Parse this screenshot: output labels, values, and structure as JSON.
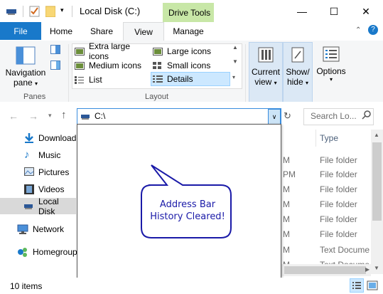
{
  "window": {
    "title": "Local Disk (C:)",
    "context_tab": "Drive Tools",
    "minimize": "—",
    "maximize": "☐",
    "close": "✕"
  },
  "tabs": [
    {
      "label": "File"
    },
    {
      "label": "Home"
    },
    {
      "label": "Share"
    },
    {
      "label": "View"
    },
    {
      "label": "Manage"
    }
  ],
  "ribbon": {
    "panes": {
      "nav_pane_line1": "Navigation",
      "nav_pane_line2": "pane",
      "group_label": "Panes"
    },
    "layout": {
      "group_label": "Layout",
      "items": [
        "Extra large icons",
        "Large icons",
        "Medium icons",
        "Small icons",
        "List",
        "Details"
      ],
      "selected": "Details"
    },
    "current_view": {
      "line1": "Current",
      "line2": "view"
    },
    "show_hide": {
      "line1": "Show/",
      "line2": "hide"
    },
    "options": {
      "label": "Options"
    }
  },
  "address": {
    "path": "C:\\",
    "search_placeholder": "Search Lo..."
  },
  "nav_pane": {
    "items": [
      {
        "label": "Download",
        "icon": "download-arrow-icon"
      },
      {
        "label": "Music",
        "icon": "music-note-icon"
      },
      {
        "label": "Pictures",
        "icon": "pictures-icon"
      },
      {
        "label": "Videos",
        "icon": "videos-icon"
      },
      {
        "label": "Local Disk",
        "icon": "drive-icon"
      },
      {
        "label": "Network",
        "icon": "network-icon"
      },
      {
        "label": "Homegroup",
        "icon": "homegroup-icon"
      }
    ]
  },
  "list": {
    "type_header": "Type",
    "rows": [
      {
        "date_tail": "M",
        "type": "File folder"
      },
      {
        "date_tail": "PM",
        "type": "File folder"
      },
      {
        "date_tail": "M",
        "type": "File folder"
      },
      {
        "date_tail": "M",
        "type": "File folder"
      },
      {
        "date_tail": "M",
        "type": "File folder"
      },
      {
        "date_tail": "M",
        "type": "File folder"
      },
      {
        "date_tail": "M",
        "type": "Text Documen"
      },
      {
        "date_tail": "M",
        "type": "Text Documen"
      }
    ]
  },
  "callout": {
    "line1": "Address Bar",
    "line2": "History Cleared!"
  },
  "status": {
    "items_count": "10 items"
  },
  "colors": {
    "accent": "#1979ca",
    "drive_tools": "#c8e7a7",
    "callout_border": "#1a1aa8",
    "callout_text": "#1a1aa8"
  }
}
